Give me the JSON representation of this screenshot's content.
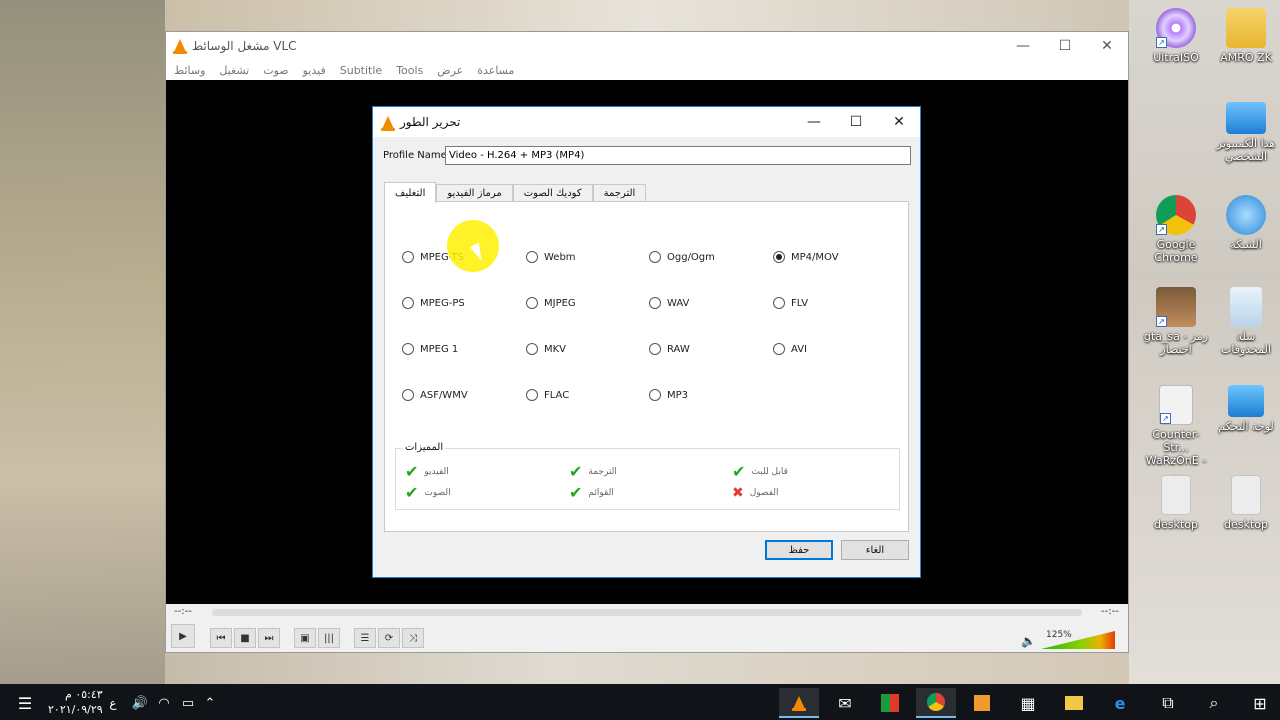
{
  "vlc": {
    "title": "مشغل الوسائط VLC",
    "menu": [
      "وسائط",
      "تشغيل",
      "صوت",
      "فيديو",
      "Subtitle",
      "Tools",
      "عرض",
      "مساعدة"
    ],
    "time_left": "--:--",
    "time_right": "--:--",
    "volume": "125%"
  },
  "dialog": {
    "title": "تحرير الطور",
    "profile_label": "Profile Name",
    "profile_value": "Video - H.264 + MP3 (MP4)",
    "tabs": [
      "التغليف",
      "مرماز الفيديو",
      "كوديك الصوت",
      "الترجمة"
    ],
    "formats": [
      {
        "label": "MPEG-TS",
        "checked": false
      },
      {
        "label": "Webm",
        "checked": false
      },
      {
        "label": "Ogg/Ogm",
        "checked": false
      },
      {
        "label": "MP4/MOV",
        "checked": true
      },
      {
        "label": "MPEG-PS",
        "checked": false
      },
      {
        "label": "MJPEG",
        "checked": false
      },
      {
        "label": "WAV",
        "checked": false
      },
      {
        "label": "FLV",
        "checked": false
      },
      {
        "label": "MPEG 1",
        "checked": false
      },
      {
        "label": "MKV",
        "checked": false
      },
      {
        "label": "RAW",
        "checked": false
      },
      {
        "label": "AVI",
        "checked": false
      },
      {
        "label": "ASF/WMV",
        "checked": false
      },
      {
        "label": "FLAC",
        "checked": false
      },
      {
        "label": "MP3",
        "checked": false
      }
    ],
    "features_title": "المميزات",
    "features": [
      {
        "label": "الفيديو",
        "ok": true
      },
      {
        "label": "الترجمة",
        "ok": true
      },
      {
        "label": "قابل للبث",
        "ok": true
      },
      {
        "label": "الصوت",
        "ok": true
      },
      {
        "label": "القوائم",
        "ok": true
      },
      {
        "label": "الفصول",
        "ok": false
      }
    ],
    "save_label": "حفظ",
    "cancel_label": "الغاء"
  },
  "desktop_icons": [
    {
      "label": "UltraISO",
      "icon": "disc-icon"
    },
    {
      "label": "AMRO ZK",
      "icon": "user-folder-icon"
    },
    {
      "label": "هذا الكمبيوتر الشخصي",
      "icon": "computer-icon"
    },
    {
      "label": "Google Chrome",
      "icon": "chrome-icon"
    },
    {
      "label": "الشبكة",
      "icon": "network-icon"
    },
    {
      "label": "gta_sa - رمز اختصار",
      "icon": "game-icon"
    },
    {
      "label": "سلة المحذوفات",
      "icon": "recycle-bin-icon"
    },
    {
      "label": "Counter-Str... WaRzOnE - ...",
      "icon": "settings-file-icon"
    },
    {
      "label": "لوحة التحكم",
      "icon": "control-panel-icon"
    },
    {
      "label": "desktop",
      "icon": "file-icon"
    },
    {
      "label": "desktop",
      "icon": "file-icon"
    }
  ],
  "taskbar": {
    "time": "٠٥:٤٣ م",
    "date": "٢٠٢١/٠٩/٢٩",
    "lang": "ع"
  }
}
